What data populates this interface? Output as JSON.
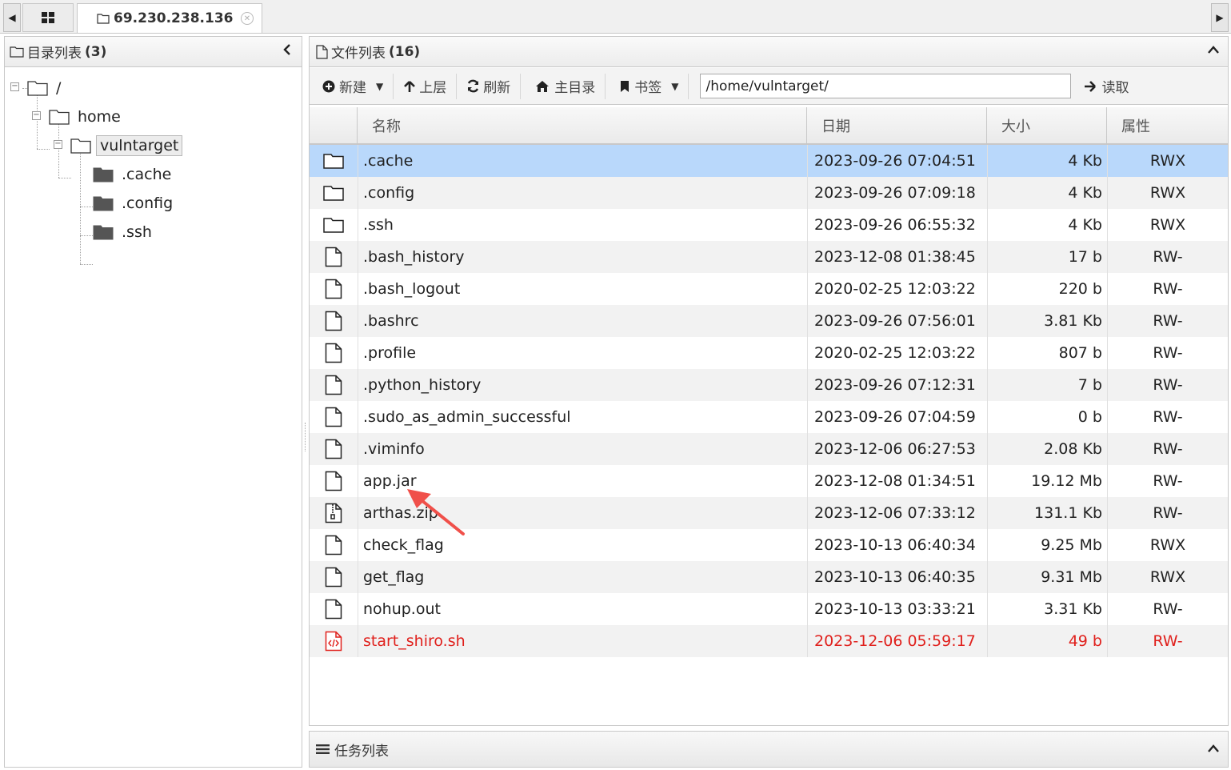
{
  "tabbar": {
    "host_tab": "69.230.238.136"
  },
  "left_pane": {
    "title": "目录列表",
    "count": "(3)",
    "tree": [
      {
        "label": "/"
      },
      {
        "label": "home"
      },
      {
        "label": "vulntarget"
      },
      {
        "label": ".cache"
      },
      {
        "label": ".config"
      },
      {
        "label": ".ssh"
      }
    ]
  },
  "right_pane": {
    "title": "文件列表",
    "count": "(16)",
    "toolbar": {
      "new_label": "新建",
      "up_label": "上层",
      "refresh_label": "刷新",
      "home_label": "主目录",
      "bookmark_label": "书签",
      "path_value": "/home/vulntarget/",
      "read_label": "读取"
    },
    "columns": {
      "name": "名称",
      "date": "日期",
      "size": "大小",
      "attr": "属性"
    },
    "files": [
      {
        "name": ".cache",
        "date": "2023-09-26 07:04:51",
        "size": "4 Kb",
        "attr": "RWX",
        "type": "folder"
      },
      {
        "name": ".config",
        "date": "2023-09-26 07:09:18",
        "size": "4 Kb",
        "attr": "RWX",
        "type": "folder"
      },
      {
        "name": ".ssh",
        "date": "2023-09-26 06:55:32",
        "size": "4 Kb",
        "attr": "RWX",
        "type": "folder"
      },
      {
        "name": ".bash_history",
        "date": "2023-12-08 01:38:45",
        "size": "17 b",
        "attr": "RW-",
        "type": "file"
      },
      {
        "name": ".bash_logout",
        "date": "2020-02-25 12:03:22",
        "size": "220 b",
        "attr": "RW-",
        "type": "file"
      },
      {
        "name": ".bashrc",
        "date": "2023-09-26 07:56:01",
        "size": "3.81 Kb",
        "attr": "RW-",
        "type": "file"
      },
      {
        "name": ".profile",
        "date": "2020-02-25 12:03:22",
        "size": "807 b",
        "attr": "RW-",
        "type": "file"
      },
      {
        "name": ".python_history",
        "date": "2023-09-26 07:12:31",
        "size": "7 b",
        "attr": "RW-",
        "type": "file"
      },
      {
        "name": ".sudo_as_admin_successful",
        "date": "2023-09-26 07:04:59",
        "size": "0 b",
        "attr": "RW-",
        "type": "file"
      },
      {
        "name": ".viminfo",
        "date": "2023-12-06 06:27:53",
        "size": "2.08 Kb",
        "attr": "RW-",
        "type": "file"
      },
      {
        "name": "app.jar",
        "date": "2023-12-08 01:34:51",
        "size": "19.12 Mb",
        "attr": "RW-",
        "type": "file"
      },
      {
        "name": "arthas.zip",
        "date": "2023-12-06 07:33:12",
        "size": "131.1 Kb",
        "attr": "RW-",
        "type": "zip"
      },
      {
        "name": "check_flag",
        "date": "2023-10-13 06:40:34",
        "size": "9.25 Mb",
        "attr": "RWX",
        "type": "file"
      },
      {
        "name": "get_flag",
        "date": "2023-10-13 06:40:35",
        "size": "9.31 Mb",
        "attr": "RWX",
        "type": "file"
      },
      {
        "name": "nohup.out",
        "date": "2023-10-13 03:33:21",
        "size": "3.31 Kb",
        "attr": "RW-",
        "type": "file"
      },
      {
        "name": "start_shiro.sh",
        "date": "2023-12-06 05:59:17",
        "size": "49 b",
        "attr": "RW-",
        "type": "code"
      }
    ]
  },
  "task_pane": {
    "title": "任务列表"
  },
  "colors": {
    "selected_row": "#b9d8fb",
    "highlight_text": "#e0201c",
    "annotation_arrow": "#f0504a"
  }
}
